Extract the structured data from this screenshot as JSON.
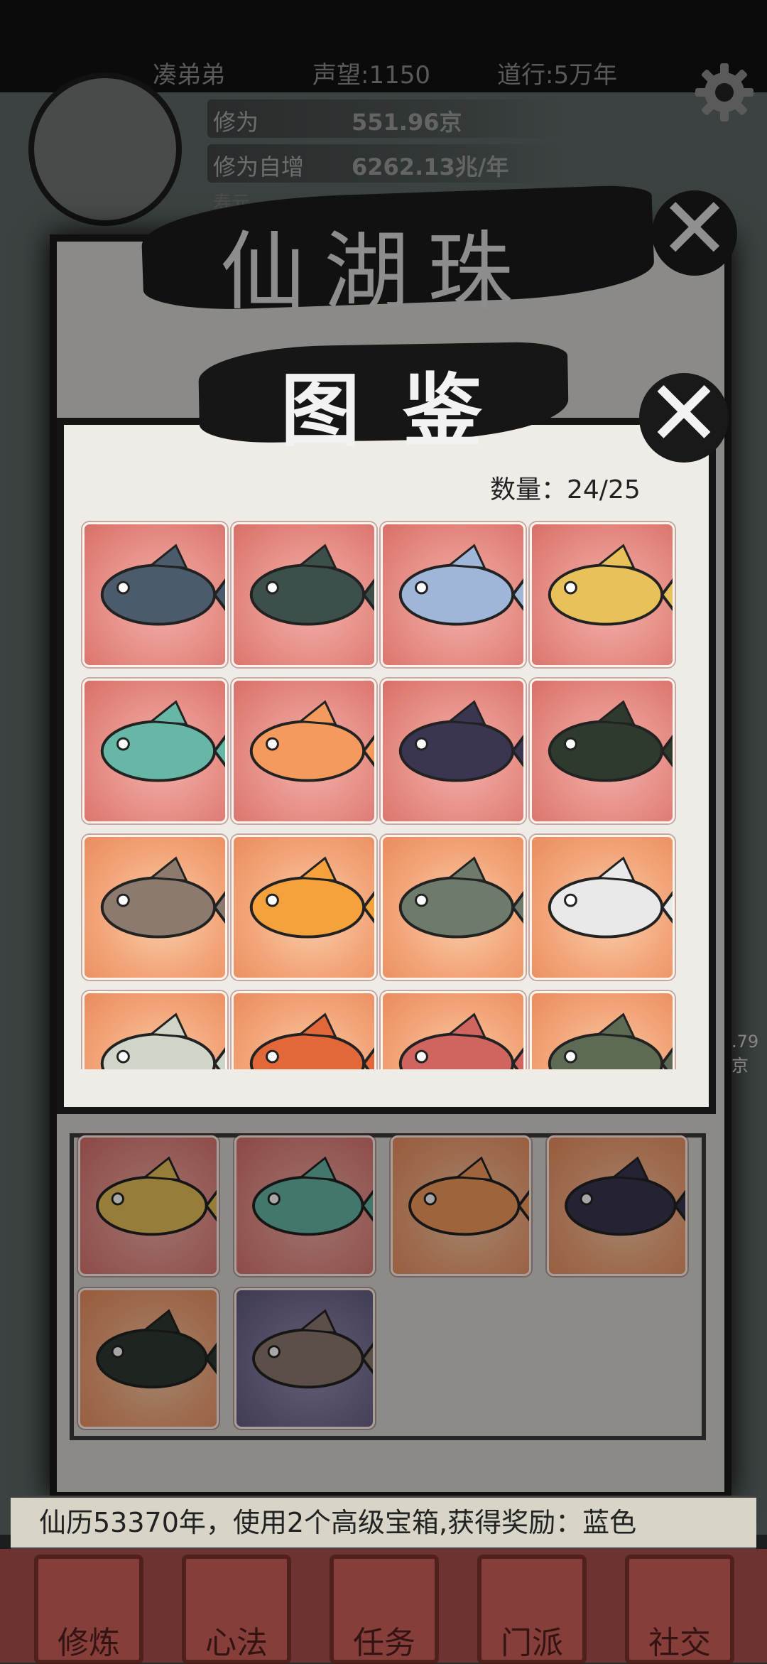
{
  "header": {
    "player_name": "凑弟弟",
    "reputation_label": "声望:1150",
    "daoxing_label": "道行:5万年",
    "settings_icon": "gear-icon"
  },
  "stats": {
    "cultivation_label": "修为",
    "cultivation_value": "551.96京",
    "growth_label": "修为自增",
    "growth_value": "6262.13兆/年",
    "third_label": "寿元"
  },
  "back_panel": {
    "title": "仙湖珠"
  },
  "codex": {
    "title": "图鉴",
    "count_text": "数量：24/25",
    "side_value": ".79京",
    "fish": [
      {
        "name": "whale-shark",
        "rarity": "red"
      },
      {
        "name": "sea-dragon",
        "rarity": "red"
      },
      {
        "name": "blue-fish",
        "rarity": "red"
      },
      {
        "name": "golden-dragon-fish",
        "rarity": "red"
      },
      {
        "name": "rainbow-dragon-fish",
        "rarity": "red"
      },
      {
        "name": "phoenix-goldfish",
        "rarity": "red"
      },
      {
        "name": "dark-fang-fish",
        "rarity": "red"
      },
      {
        "name": "anglerfish",
        "rarity": "red"
      },
      {
        "name": "tiger-shark",
        "rarity": "orange"
      },
      {
        "name": "golden-carp",
        "rarity": "orange"
      },
      {
        "name": "paddlefish",
        "rarity": "orange"
      },
      {
        "name": "white-fish",
        "rarity": "orange"
      },
      {
        "name": "crown-fish",
        "rarity": "orange"
      },
      {
        "name": "lionfish",
        "rarity": "orange"
      },
      {
        "name": "red-shark",
        "rarity": "orange"
      },
      {
        "name": "gar",
        "rarity": "orange"
      }
    ]
  },
  "collected": [
    {
      "name": "whale-shark",
      "rarity": "red"
    },
    {
      "name": "blue-fish",
      "rarity": "red"
    },
    {
      "name": "white-fish",
      "rarity": "orange"
    },
    {
      "name": "crown-fish",
      "rarity": "orange"
    },
    {
      "name": "lionfish",
      "rarity": "orange"
    },
    {
      "name": "pufferfish",
      "rarity": "purple"
    }
  ],
  "log": {
    "text": "仙历53370年，使用2个高级宝箱,获得奖励：蓝色"
  },
  "nav": [
    {
      "label": "修炼"
    },
    {
      "label": "心法"
    },
    {
      "label": "任务"
    },
    {
      "label": "门派"
    },
    {
      "label": "社交"
    }
  ],
  "colors": {
    "red_card": "#e68e86",
    "orange_card": "#f3a67a",
    "purple_card": "#7a7196",
    "ink": "#161616"
  }
}
